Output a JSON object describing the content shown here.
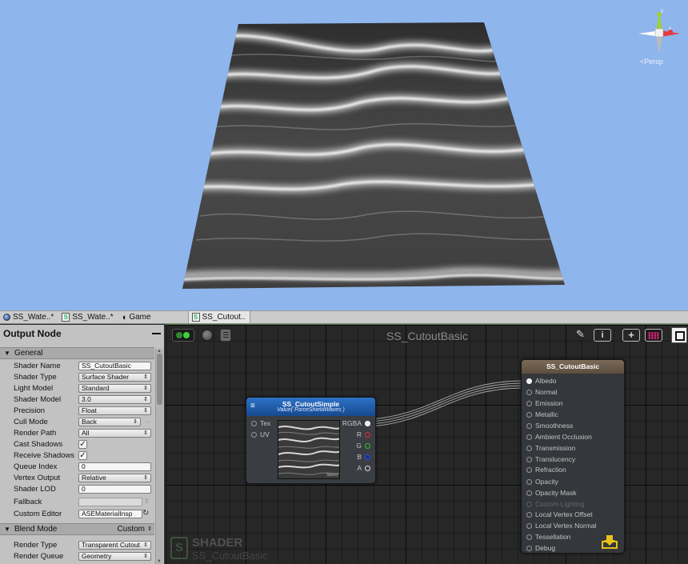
{
  "scene": {
    "gizmo_label": "<Persp",
    "colors": {
      "sky": "#8eb5ec"
    }
  },
  "tabs": [
    {
      "label": "SS_Wate..*",
      "icon": "sphere-icon"
    },
    {
      "label": "SS_Wate..*",
      "icon": "shader-icon",
      "icon_glyph": "S"
    },
    {
      "label": "Game",
      "icon": "camera-icon",
      "icon_glyph": "◖"
    },
    {
      "label": "SS_Cutout..",
      "icon": "shader-icon",
      "icon_glyph": "S",
      "active": true
    }
  ],
  "left_panel": {
    "title": "Output Node",
    "general": {
      "title": "General",
      "fields": [
        {
          "label": "Shader Name",
          "value": "SS_CutoutBasic"
        },
        {
          "label": "Shader Type",
          "value": "Surface Shader"
        },
        {
          "label": "Light Model",
          "value": "Standard"
        },
        {
          "label": "Shader Model",
          "value": "3.0"
        },
        {
          "label": "Precision",
          "value": "Float"
        },
        {
          "label": "Cull Mode",
          "value": "Back"
        },
        {
          "label": "Render Path",
          "value": "All"
        },
        {
          "label": "Cast Shadows",
          "value": "✓"
        },
        {
          "label": "Receive Shadows",
          "value": "✓"
        },
        {
          "label": "Queue Index",
          "value": "0"
        },
        {
          "label": "Vertex Output",
          "value": "Relative"
        },
        {
          "label": "Shader LOD",
          "value": "0"
        },
        {
          "label": "Fallback",
          "value": ""
        },
        {
          "label": "Custom Editor",
          "value": "ASEMaterialInsp"
        }
      ]
    },
    "blend": {
      "title": "Blend Mode",
      "value": "Custom",
      "fields": [
        {
          "label": "Render Type",
          "value": "Transparent Cutout"
        },
        {
          "label": "Render Queue",
          "value": "Geometry"
        }
      ]
    }
  },
  "graph": {
    "title": "SS_CutoutBasic",
    "texture_node": {
      "title": "SS_CutoutSimple",
      "subtitle": "Value( ForceShieldWaves )",
      "inputs": [
        "Tex",
        "UV"
      ],
      "outputs": [
        {
          "label": "RGBA",
          "color": "#eeeeee"
        },
        {
          "label": "R",
          "color": "#e03030"
        },
        {
          "label": "G",
          "color": "#30c030"
        },
        {
          "label": "B",
          "color": "#3050e0"
        },
        {
          "label": "A",
          "color": "#dddddd"
        }
      ],
      "preview_label": "Select"
    },
    "output_node": {
      "title": "SS_CutoutBasic",
      "ports": [
        "Albedo",
        "Normal",
        "Emission",
        "Metallic",
        "Smoothness",
        "Ambient Occlusion",
        "Transmission",
        "Translucency",
        "Refraction",
        "Opacity",
        "Opacity Mask",
        "Custom Lighting",
        "Local Vertex Offset",
        "Local Vertex Normal",
        "Tessellation",
        "Debug"
      ],
      "disabled_port": "Custom Lighting"
    },
    "watermark": {
      "line1": "SHADER",
      "line2": "SS_CutoutBasic",
      "logo": "S"
    },
    "toolbar": {
      "info_label": "i",
      "share_label": "+"
    }
  }
}
